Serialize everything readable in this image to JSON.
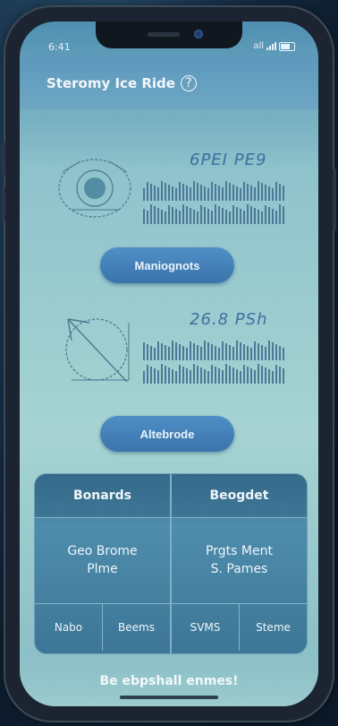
{
  "status": {
    "time": "6:41",
    "carrier": "all"
  },
  "header": {
    "title": "Steromy Ice Ride",
    "help_icon": "?"
  },
  "cards": [
    {
      "reading": "6PEI PE9",
      "icon": "camera-sketch-icon"
    },
    {
      "reading": "26.8 PSh",
      "icon": "compass-sketch-icon"
    }
  ],
  "buttons": {
    "primary": "Maniognots",
    "secondary": "Altebrode"
  },
  "panel": {
    "left": {
      "header": "Bonards",
      "body_line1": "Geo Brome",
      "body_line2": "Plme",
      "foot_a": "Nabo",
      "foot_b": "Beems"
    },
    "right": {
      "header": "Beogdet",
      "body_line1": "Prgts Ment",
      "body_line2": "S. Pames",
      "foot_a": "SVMS",
      "foot_b": "Steme"
    }
  },
  "footer": {
    "text": "Be ebpshall enmes!"
  },
  "colors": {
    "accent": "#3f7bb3",
    "panel": "#3a7393",
    "screen_top": "#4f8fb2"
  }
}
